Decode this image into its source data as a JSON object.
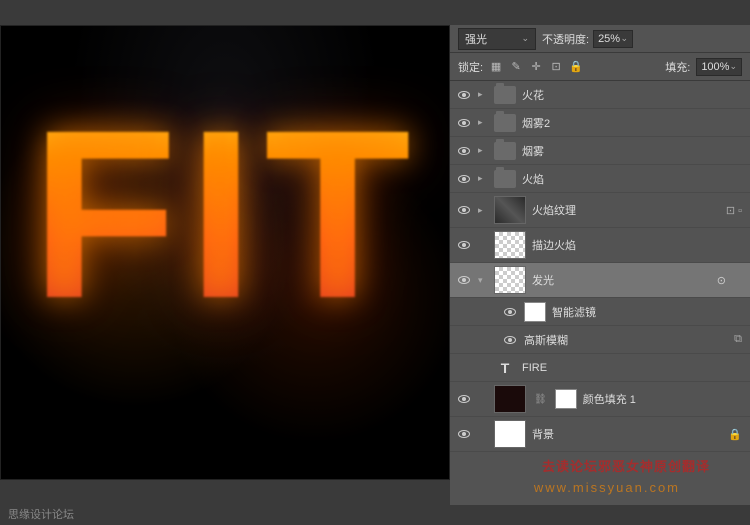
{
  "toolbar": {
    "blend_mode": "强光",
    "opacity_label": "不透明度:",
    "opacity_value": "25%",
    "lock_label": "锁定:",
    "fill_label": "填充:",
    "fill_value": "100%"
  },
  "layers": [
    {
      "name": "火花",
      "type": "folder",
      "visible": true,
      "expanded": false
    },
    {
      "name": "烟雾2",
      "type": "folder",
      "visible": true,
      "expanded": false
    },
    {
      "name": "烟雾",
      "type": "folder",
      "visible": true,
      "expanded": false
    },
    {
      "name": "火焰",
      "type": "folder",
      "visible": true,
      "expanded": false
    },
    {
      "name": "火焰纹理",
      "type": "smart",
      "visible": true,
      "thumb": "tex"
    },
    {
      "name": "描边火焰",
      "type": "layer",
      "visible": true,
      "thumb": "checker"
    },
    {
      "name": "发光",
      "type": "smart",
      "visible": true,
      "thumb": "checker",
      "selected": true,
      "expanded": true,
      "fx": true
    },
    {
      "name": "智能滤镜",
      "type": "filter-header",
      "visible": true,
      "sub": true
    },
    {
      "name": "高斯模糊",
      "type": "filter",
      "visible": true,
      "sub": true
    },
    {
      "name": "FIRE",
      "type": "text",
      "visible": false
    },
    {
      "name": "颜色填充 1",
      "type": "fill",
      "visible": true,
      "thumb": "dark",
      "mask": true
    },
    {
      "name": "背景",
      "type": "layer",
      "visible": true,
      "thumb": "white",
      "locked": true
    }
  ],
  "canvas_text": "FIT",
  "watermarks": {
    "red": "去读论坛邪恶女神原创翻译",
    "orange": "www.missyuan.com"
  },
  "footer": "思缘设计论坛"
}
